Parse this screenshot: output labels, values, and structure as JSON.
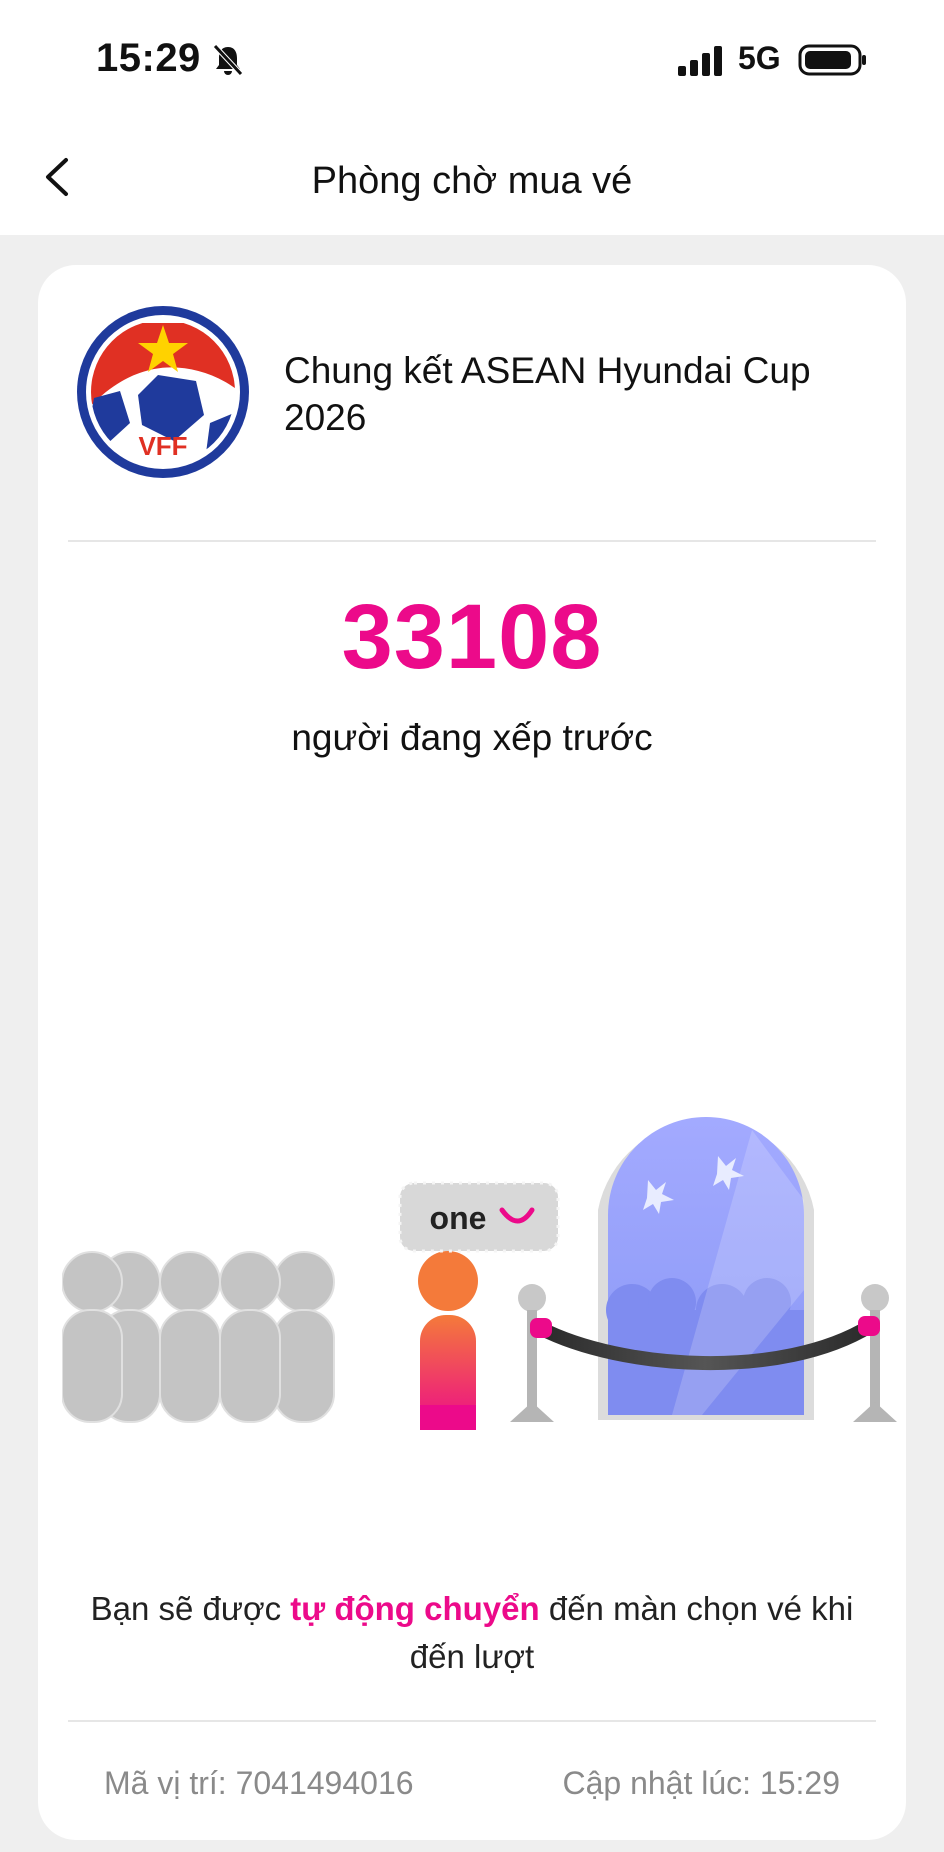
{
  "status_bar": {
    "time": "15:29",
    "network": "5G",
    "icons": [
      "bell-slash-icon",
      "signal-icon",
      "battery-icon"
    ]
  },
  "header": {
    "title": "Phòng chờ mua vé",
    "back_icon": "chevron-left-icon"
  },
  "event": {
    "logo_text": "VFF",
    "title": "Chung kết ASEAN Hyundai Cup 2026"
  },
  "queue": {
    "count": "33108",
    "caption": "người đang xếp trước"
  },
  "illustration": {
    "brand": "one"
  },
  "notice": {
    "part1": "Bạn sẽ được ",
    "highlight": "tự động chuyển",
    "part2": " đến màn chọn vé khi đến lượt"
  },
  "footer": {
    "position_label": "Mã vị trí: 7041494016",
    "updated_label": "Cập nhật lúc: 15:29"
  },
  "colors": {
    "accent": "#ec0a8a",
    "background": "#efefef",
    "card": "#ffffff",
    "muted_text": "#8a8a8a"
  }
}
